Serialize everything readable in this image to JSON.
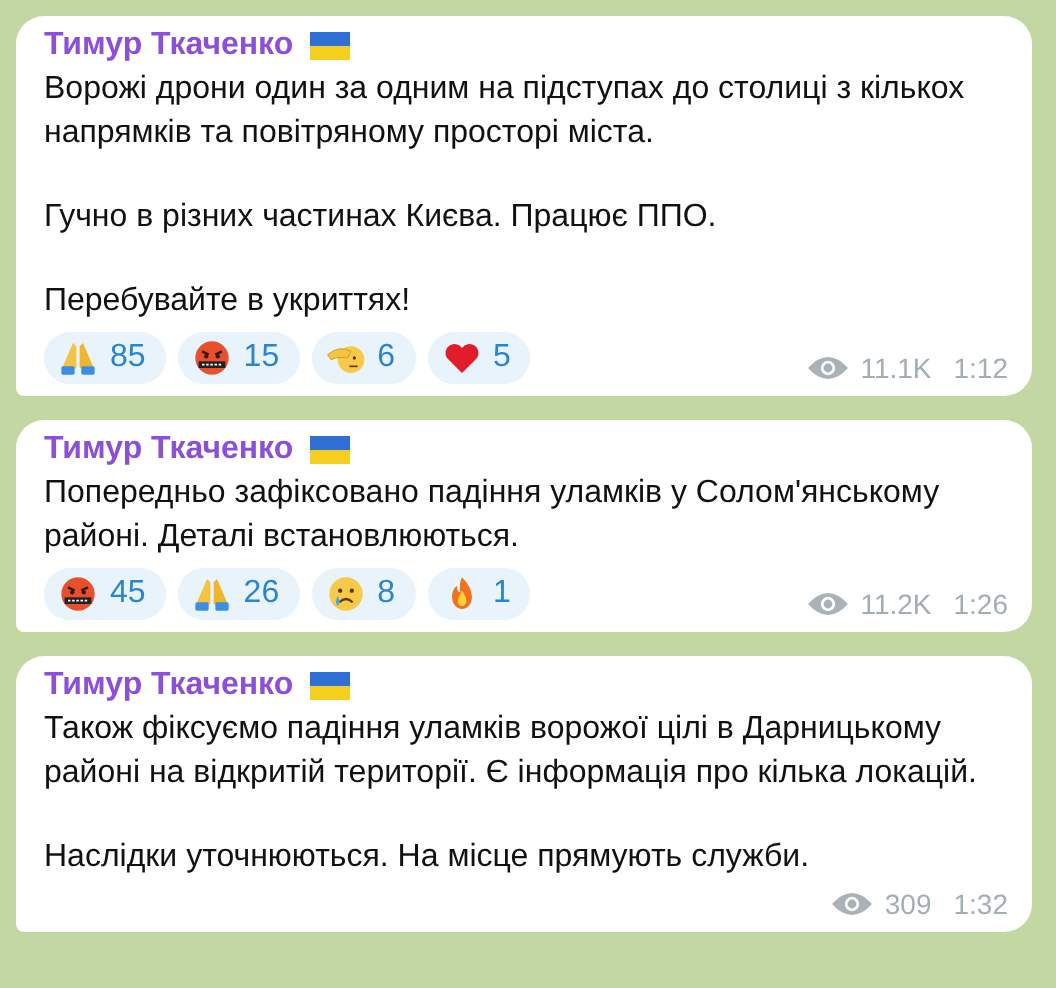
{
  "messages": [
    {
      "author": "Тимур Ткаченко",
      "paragraphs": [
        "Ворожі дрони один за одним на підступах до столиці з кількох напрямків та повітряному просторі міста.",
        "Гучно в різних частинах Києва. Працює ППО.",
        "Перебувайте в укриттях!"
      ],
      "reactions": [
        {
          "kind": "pray",
          "count": "85"
        },
        {
          "kind": "cursing",
          "count": "15"
        },
        {
          "kind": "salute",
          "count": "6"
        },
        {
          "kind": "heart",
          "count": "5"
        }
      ],
      "views": "11.1K",
      "time": "1:12"
    },
    {
      "author": "Тимур Ткаченко",
      "paragraphs": [
        "Попередньо зафіксовано падіння уламків у Солом'янському районі. Деталі встановлюються."
      ],
      "reactions": [
        {
          "kind": "cursing",
          "count": "45"
        },
        {
          "kind": "pray",
          "count": "26"
        },
        {
          "kind": "crying",
          "count": "8"
        },
        {
          "kind": "fire",
          "count": "1"
        }
      ],
      "views": "11.2K",
      "time": "1:26"
    },
    {
      "author": "Тимур Ткаченко",
      "paragraphs": [
        "Також фіксуємо падіння уламків ворожої цілі в Дарницькому районі на відкритій території. Є інформація про кілька локацій.",
        "Наслідки уточнюються. На місце прямують служби."
      ],
      "views": "309",
      "time": "1:32"
    }
  ]
}
